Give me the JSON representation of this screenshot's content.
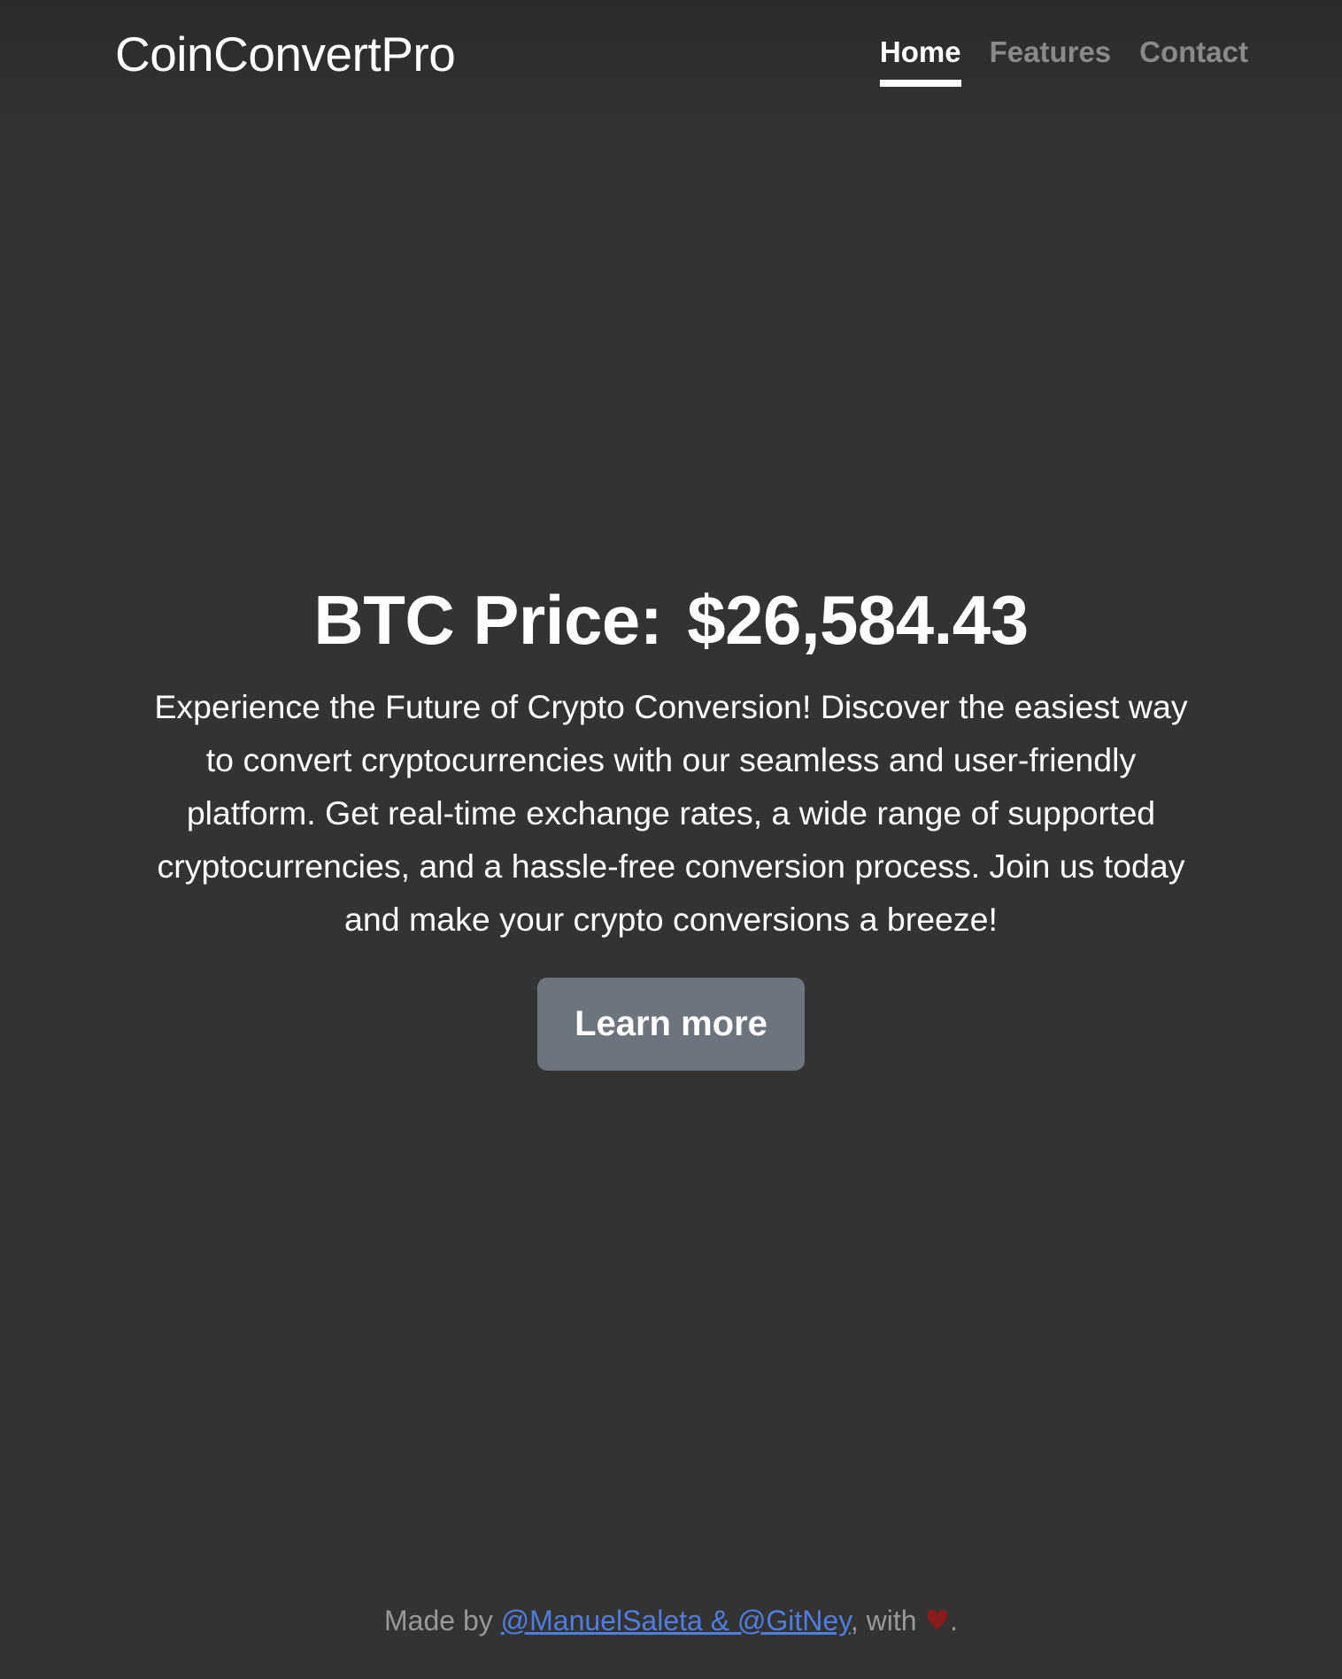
{
  "header": {
    "brand": "CoinConvertPro",
    "nav": [
      {
        "label": "Home",
        "active": true
      },
      {
        "label": "Features",
        "active": false
      },
      {
        "label": "Contact",
        "active": false
      }
    ]
  },
  "hero": {
    "price_label": "BTC Price:",
    "price_value": "$26,584.43",
    "description": "Experience the Future of Crypto Conversion! Discover the easiest way to convert cryptocurrencies with our seamless and user-friendly platform. Get real-time exchange rates, a wide range of supported cryptocurrencies, and a hassle-free conversion process. Join us today and make your crypto conversions a breeze!",
    "cta_label": "Learn more"
  },
  "footer": {
    "prefix": "Made by ",
    "link_text": "@ManuelSaleta & @GitNey",
    "middle": ", with ",
    "heart": "♥",
    "suffix": "."
  },
  "colors": {
    "background": "#333333",
    "button": "#6c757d",
    "link": "#4f7ee0",
    "nav_inactive": "#8a8a8a",
    "heart": "#8b1a1a"
  }
}
